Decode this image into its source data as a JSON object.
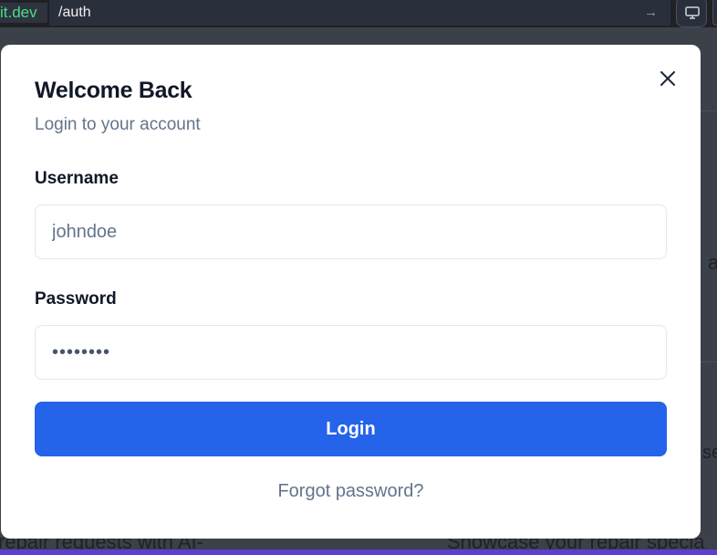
{
  "browser": {
    "domain_fragment": "it.dev",
    "path": "/auth",
    "go_icon": "arrow-right-icon",
    "device_icon": "desktop-icon"
  },
  "background": {
    "fragment_a": "a",
    "fragment_se": "se",
    "fragment_bottom_left": "repair requests with AI-",
    "fragment_bottom_right": "Showcase your repair specia"
  },
  "modal": {
    "title": "Welcome Back",
    "subtitle": "Login to your account",
    "close_icon": "close-icon",
    "username": {
      "label": "Username",
      "placeholder": "johndoe"
    },
    "password": {
      "label": "Password",
      "value": "••••••••"
    },
    "login_label": "Login",
    "forgot_label": "Forgot password?"
  },
  "colors": {
    "primary": "#2563eb",
    "muted_text": "#64748b",
    "heading": "#111827",
    "url_domain": "#4ade80"
  }
}
